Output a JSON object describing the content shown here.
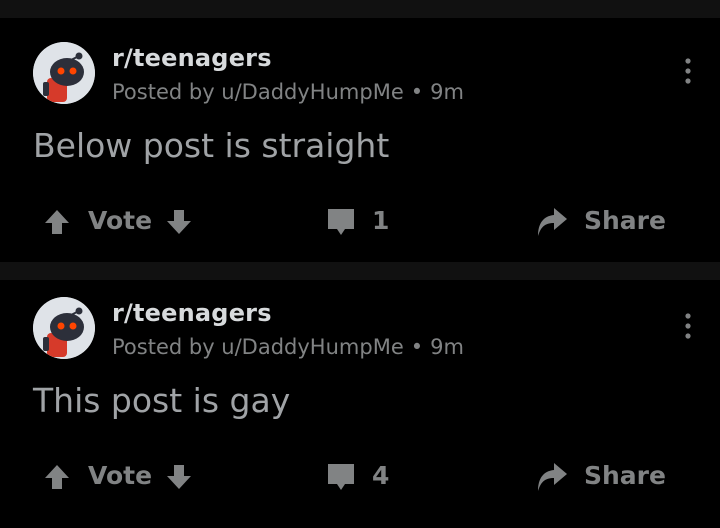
{
  "posts": [
    {
      "subreddit": "r/teenagers",
      "posted_by": "Posted by u/DaddyHumpMe",
      "separator": "•",
      "age": "9m",
      "title": "Below post is straight",
      "vote_label": "Vote",
      "comment_count": "1",
      "share_label": "Share"
    },
    {
      "subreddit": "r/teenagers",
      "posted_by": "Posted by u/DaddyHumpMe",
      "separator": "•",
      "age": "9m",
      "title": "This post is gay",
      "vote_label": "Vote",
      "comment_count": "4",
      "share_label": "Share"
    }
  ],
  "icons": {
    "upvote": "upvote-arrow-icon",
    "downvote": "downvote-arrow-icon",
    "comment": "comment-bubble-icon",
    "share": "share-arrow-icon",
    "more": "more-options-kebab-icon",
    "avatar": "subreddit-avatar-icon"
  },
  "colors": {
    "background": "#000000",
    "divider": "#111111",
    "primary_text": "#d7dadc",
    "secondary_text": "#818384",
    "title_text": "#a0a3a6"
  }
}
